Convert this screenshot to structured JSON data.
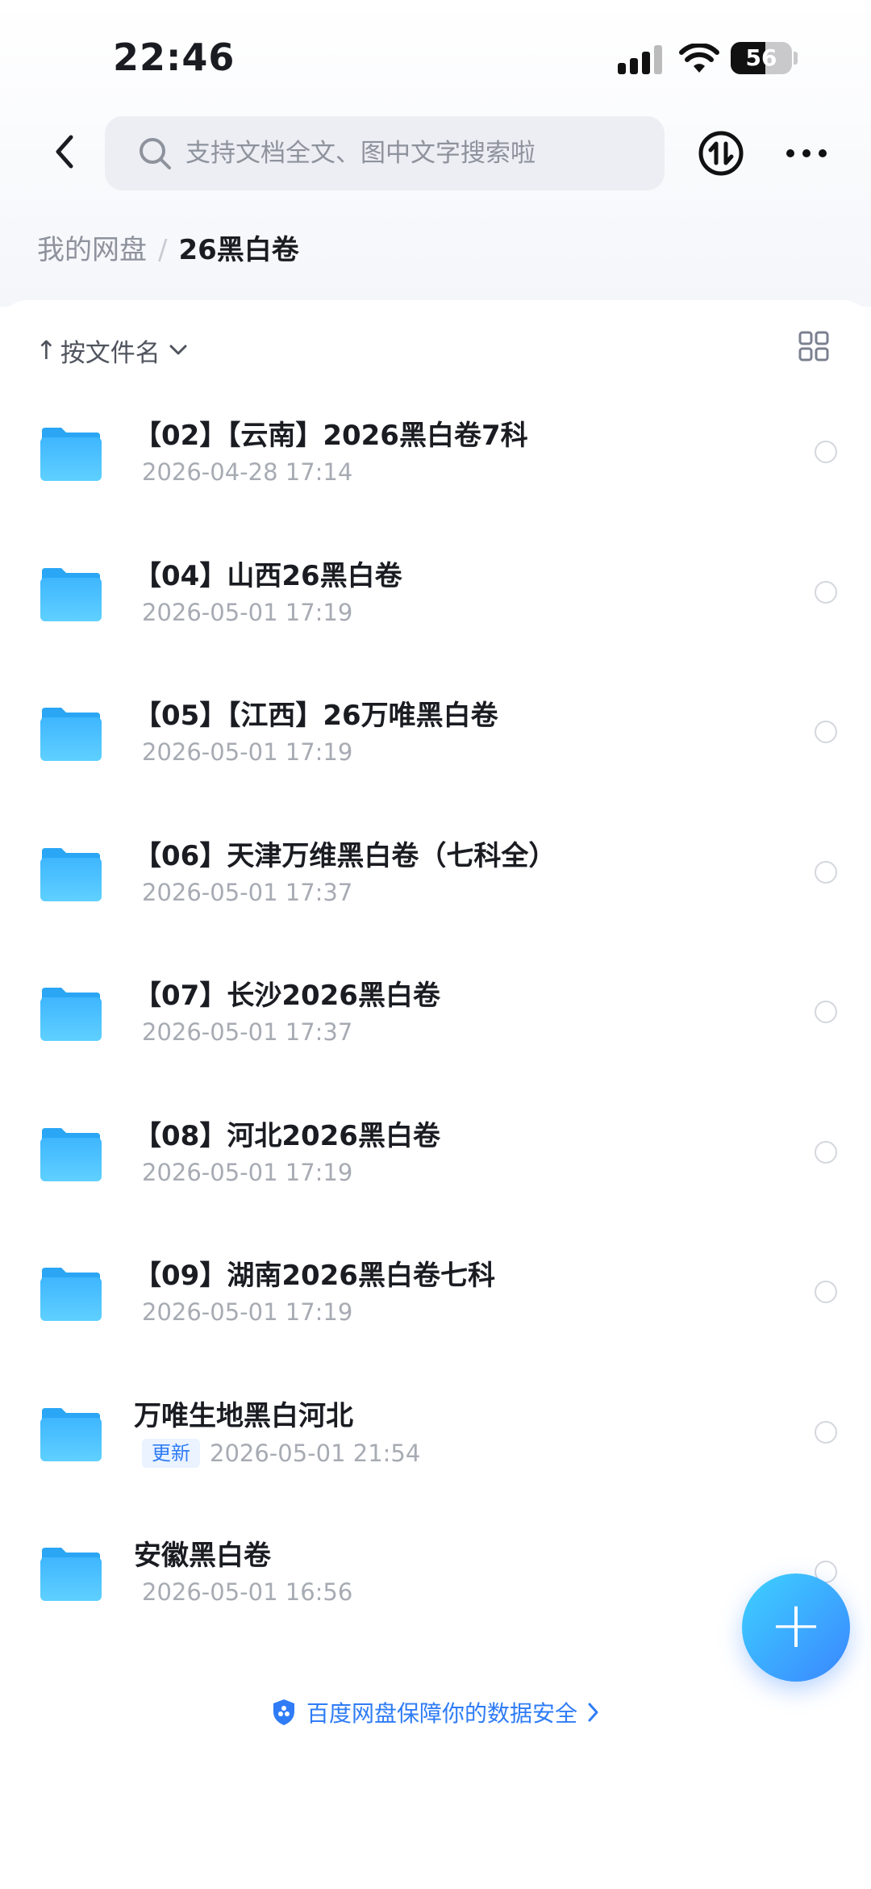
{
  "status_bar": {
    "time": "22:46",
    "battery_level": "56"
  },
  "nav": {
    "search_placeholder": "支持文档全文、图中文字搜索啦"
  },
  "breadcrumb": {
    "root": "我的网盘",
    "separator": "/",
    "current": "26黑白卷"
  },
  "toolbar": {
    "sort_arrow": "↑",
    "sort_label": "按文件名"
  },
  "files": [
    {
      "name": "【02】【云南】2026黑白卷7科",
      "date": "2026-04-28 17:14",
      "badge": ""
    },
    {
      "name": "【04】山西26黑白卷",
      "date": "2026-05-01 17:19",
      "badge": ""
    },
    {
      "name": "【05】【江西】26万唯黑白卷",
      "date": "2026-05-01 17:19",
      "badge": ""
    },
    {
      "name": "【06】天津万维黑白卷（七科全）",
      "date": "2026-05-01 17:37",
      "badge": ""
    },
    {
      "name": "【07】长沙2026黑白卷",
      "date": "2026-05-01 17:37",
      "badge": ""
    },
    {
      "name": "【08】河北2026黑白卷",
      "date": "2026-05-01 17:19",
      "badge": ""
    },
    {
      "name": "【09】湖南2026黑白卷七科",
      "date": "2026-05-01 17:19",
      "badge": ""
    },
    {
      "name": "万唯生地黑白河北",
      "date": "2026-05-01 21:54",
      "badge": "更新"
    },
    {
      "name": "安徽黑白卷",
      "date": "2026-05-01 16:56",
      "badge": ""
    }
  ],
  "footer": {
    "security_note": "百度网盘保障你的数据安全"
  },
  "fab": {
    "label": "+"
  },
  "colors": {
    "accent": "#2f7cf6",
    "folder": "#4fc3ff"
  }
}
